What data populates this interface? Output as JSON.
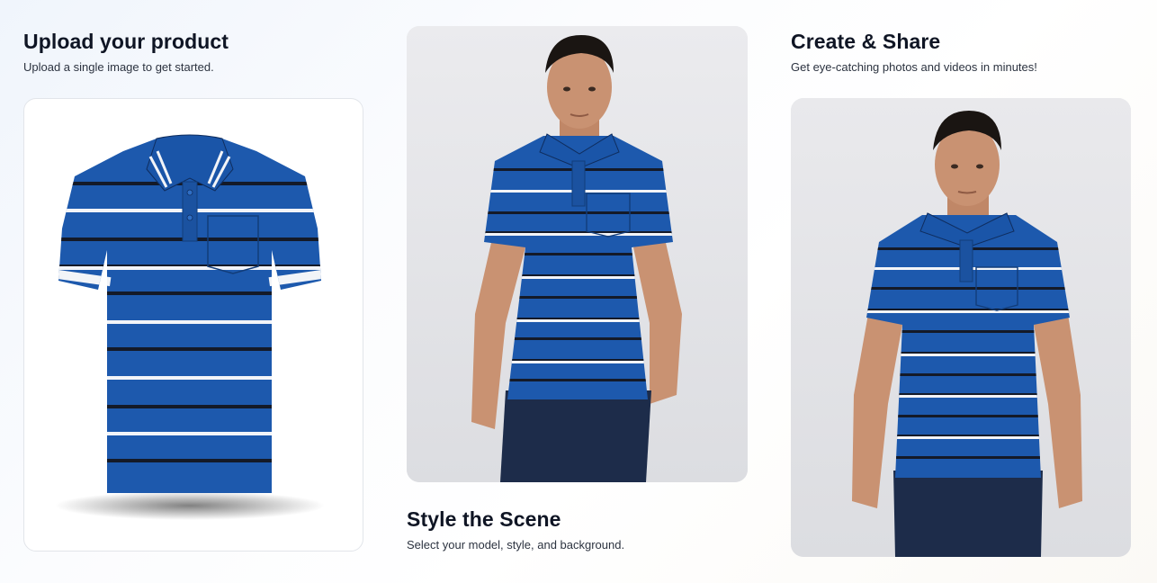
{
  "steps": {
    "upload": {
      "title": "Upload your product",
      "subtitle": "Upload a single image to get started.",
      "image_icon": "polo-shirt-product-image"
    },
    "style": {
      "title": "Style the Scene",
      "subtitle": "Select your model, style, and background.",
      "image_icon": "model-wearing-polo-image"
    },
    "share": {
      "title": "Create & Share",
      "subtitle": "Get eye-catching photos and videos in minutes!",
      "image_icon": "model-front-view-image"
    }
  },
  "colors": {
    "shirt_blue": "#1d59ad",
    "stripe_white": "#f2f4f8",
    "stripe_dark": "#141a28",
    "jeans": "#1d2c4a",
    "skin": "#c99272",
    "photo_background": "#e7e8eb"
  }
}
